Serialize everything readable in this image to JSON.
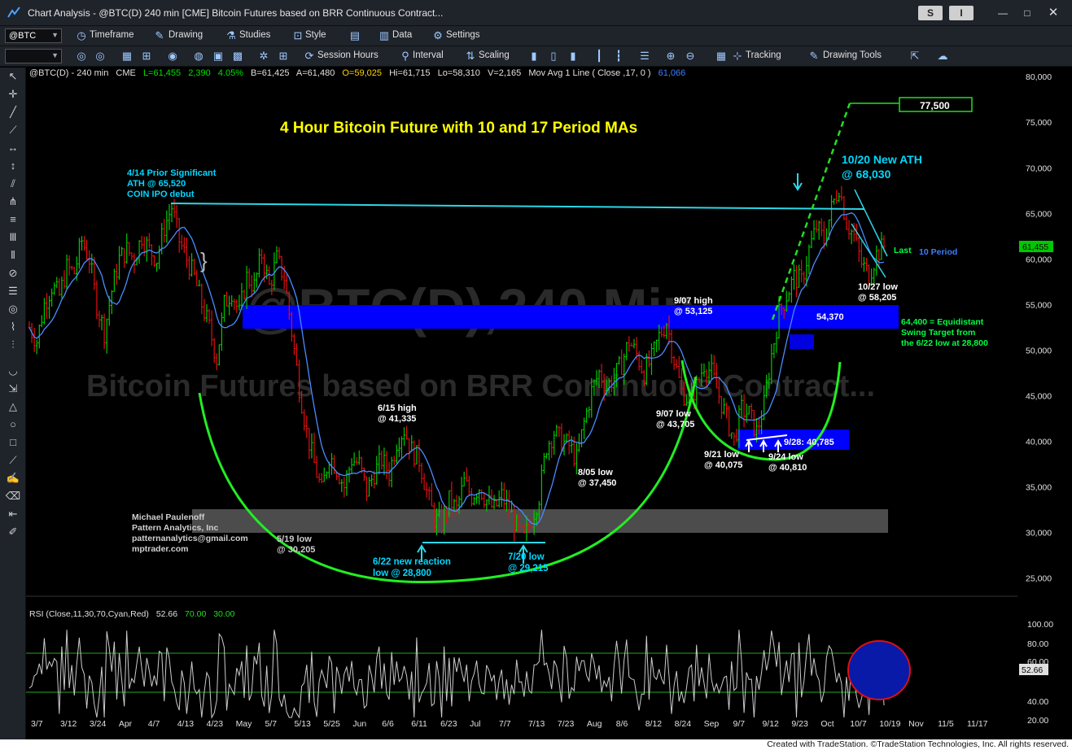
{
  "window": {
    "title": "Chart Analysis - @BTC(D) 240 min [CME] Bitcoin Futures based on BRR Continuous Contract...",
    "s_button": "S",
    "i_button": "I",
    "minimize": "—",
    "maximize": "□",
    "close": "✕"
  },
  "toolbar1": {
    "symbol": "@BTC",
    "timeframe": "Timeframe",
    "drawing": "Drawing",
    "studies": "Studies",
    "style": "Style",
    "data": "Data",
    "settings": "Settings"
  },
  "toolbar2": {
    "session_hours": "Session Hours",
    "interval": "Interval",
    "scaling": "Scaling",
    "tracking": "Tracking",
    "drawing_tools": "Drawing Tools"
  },
  "header": {
    "symbol": "@BTC(D) - 240 min",
    "exchange": "CME",
    "last": "L=61,455",
    "change": "2,390",
    "change_pct": "4.05%",
    "bid": "B=61,425",
    "ask": "A=61,480",
    "open": "O=59,025",
    "high": "Hi=61,715",
    "low": "Lo=58,310",
    "volume": "V=2,165",
    "mov_avg": "Mov Avg 1 Line ( Close ,17, 0 )",
    "mov_avg_value": "61,066"
  },
  "watermark": {
    "line1": "@BTC(D),240 Min",
    "line2": "Bitcoin Futures based on BRR Continuous Contract..."
  },
  "credit_block": {
    "name": "Michael Paulenoff",
    "company": "Pattern Analytics, Inc",
    "email": "patternanalytics@gmail.com",
    "site": "mptrader.com"
  },
  "rsi_panel": {
    "label": "RSI (Close,11,30,70,Cyan,Red)",
    "value": "52.66",
    "ob": "70.00",
    "os": "30.00",
    "axis_ticks": [
      "100.00",
      "80.00",
      "60.00",
      "40.00",
      "20.00"
    ],
    "current_value_box": "52.66"
  },
  "footer": {
    "credit": "Created with TradeStation. ©TradeStation Technologies, Inc. All rights reserved."
  },
  "chart_data": {
    "type": "line",
    "title": "4 Hour Bitcoin Future with 10 and 17 Period MAs",
    "ylim": [
      23000,
      81000
    ],
    "y_ticks": [
      80000,
      75000,
      70000,
      65000,
      60000,
      55000,
      50000,
      45000,
      40000,
      35000,
      30000,
      25000
    ],
    "y_tick_labels": [
      "80,000",
      "75,000",
      "70,000",
      "65,000",
      "60,000",
      "55,000",
      "50,000",
      "45,000",
      "40,000",
      "35,000",
      "30,000",
      "25,000"
    ],
    "x_tick_labels": [
      "3/7",
      "3/12",
      "3/24",
      "Apr",
      "4/7",
      "4/13",
      "4/23",
      "May",
      "5/7",
      "5/13",
      "5/25",
      "Jun",
      "6/6",
      "6/11",
      "6/23",
      "Jul",
      "7/7",
      "7/13",
      "7/23",
      "Aug",
      "8/6",
      "8/12",
      "8/24",
      "Sep",
      "9/7",
      "9/12",
      "9/23",
      "Oct",
      "10/7",
      "10/19",
      "Nov",
      "11/5",
      "11/17"
    ],
    "last_price_label": "61,455",
    "series_labels": [
      "Last",
      "10 Period"
    ],
    "price_path": [
      [
        0,
        52500
      ],
      [
        3,
        51000
      ],
      [
        6,
        55000
      ],
      [
        9,
        57000
      ],
      [
        12,
        56000
      ],
      [
        15,
        59000
      ],
      [
        18,
        58500
      ],
      [
        21,
        62000
      ],
      [
        24,
        60000
      ],
      [
        27,
        55000
      ],
      [
        30,
        52000
      ],
      [
        33,
        56500
      ],
      [
        36,
        60000
      ],
      [
        39,
        61000
      ],
      [
        42,
        60000
      ],
      [
        45,
        62500
      ],
      [
        48,
        61000
      ],
      [
        51,
        60000
      ],
      [
        54,
        63500
      ],
      [
        57,
        65700
      ],
      [
        60,
        62000
      ],
      [
        63,
        60000
      ],
      [
        66,
        58000
      ],
      [
        69,
        55000
      ],
      [
        72,
        52500
      ],
      [
        75,
        49000
      ],
      [
        78,
        55000
      ],
      [
        81,
        56500
      ],
      [
        84,
        54000
      ],
      [
        87,
        58000
      ],
      [
        90,
        57000
      ],
      [
        93,
        60500
      ],
      [
        96,
        57000
      ],
      [
        99,
        60000
      ],
      [
        102,
        58000
      ],
      [
        105,
        52000
      ],
      [
        108,
        46000
      ],
      [
        111,
        41000
      ],
      [
        114,
        37500
      ],
      [
        117,
        34500
      ],
      [
        120,
        38500
      ],
      [
        123,
        37000
      ],
      [
        126,
        35000
      ],
      [
        129,
        38000
      ],
      [
        132,
        37500
      ],
      [
        135,
        34500
      ],
      [
        138,
        36500
      ],
      [
        141,
        38000
      ],
      [
        144,
        36500
      ],
      [
        147,
        40000
      ],
      [
        150,
        41300
      ],
      [
        153,
        39000
      ],
      [
        156,
        38000
      ],
      [
        159,
        34500
      ],
      [
        162,
        31500
      ],
      [
        165,
        31000
      ],
      [
        168,
        33500
      ],
      [
        171,
        32500
      ],
      [
        174,
        35500
      ],
      [
        177,
        34000
      ],
      [
        180,
        35000
      ],
      [
        183,
        33500
      ],
      [
        186,
        32500
      ],
      [
        189,
        34000
      ],
      [
        192,
        32500
      ],
      [
        195,
        30500
      ],
      [
        198,
        29300
      ],
      [
        201,
        31500
      ],
      [
        204,
        34000
      ],
      [
        207,
        39500
      ],
      [
        210,
        41000
      ],
      [
        213,
        40000
      ],
      [
        216,
        39500
      ],
      [
        219,
        38000
      ],
      [
        222,
        42000
      ],
      [
        225,
        45500
      ],
      [
        228,
        47500
      ],
      [
        231,
        46000
      ],
      [
        234,
        47000
      ],
      [
        237,
        48500
      ],
      [
        240,
        51000
      ],
      [
        243,
        49500
      ],
      [
        246,
        47500
      ],
      [
        249,
        49000
      ],
      [
        252,
        51500
      ],
      [
        255,
        53100
      ],
      [
        258,
        49000
      ],
      [
        261,
        45500
      ],
      [
        264,
        44500
      ],
      [
        267,
        46000
      ],
      [
        270,
        48500
      ],
      [
        273,
        47500
      ],
      [
        276,
        45000
      ],
      [
        279,
        42500
      ],
      [
        282,
        40100
      ],
      [
        285,
        43500
      ],
      [
        288,
        43000
      ],
      [
        291,
        41000
      ],
      [
        294,
        44000
      ],
      [
        297,
        49500
      ],
      [
        300,
        54000
      ],
      [
        303,
        56000
      ],
      [
        306,
        58000
      ],
      [
        309,
        57500
      ],
      [
        312,
        61000
      ],
      [
        315,
        63500
      ],
      [
        318,
        62000
      ],
      [
        321,
        65500
      ],
      [
        324,
        68000
      ],
      [
        327,
        64000
      ],
      [
        330,
        62500
      ],
      [
        333,
        59500
      ],
      [
        336,
        58200
      ],
      [
        339,
        60500
      ],
      [
        342,
        61455
      ]
    ],
    "annotations": [
      {
        "text": "4/14 Prior Significant",
        "color": "#00d8ff"
      },
      {
        "text": "ATH @ 65,520",
        "color": "#00d8ff"
      },
      {
        "text": "COIN IPO debut",
        "color": "#00d8ff"
      },
      {
        "text": "10/20 New ATH",
        "color": "#00d8ff"
      },
      {
        "text": "@ 68,030",
        "color": "#00d8ff"
      },
      {
        "text": "77,500",
        "color": "#ffffff"
      },
      {
        "text": "9/07 high",
        "color": "#ffffff"
      },
      {
        "text": "@ 53,125",
        "color": "#ffffff"
      },
      {
        "text": "54,370",
        "color": "#ffffff"
      },
      {
        "text": "10/27 low",
        "color": "#ffffff"
      },
      {
        "text": "@ 58,205",
        "color": "#ffffff"
      },
      {
        "text": "64,400 = Equidistant",
        "color": "#00ff44"
      },
      {
        "text": "Swing Target from",
        "color": "#00ff44"
      },
      {
        "text": "the 6/22 low at 28,800",
        "color": "#00ff44"
      },
      {
        "text": "6/15 high",
        "color": "#ffffff"
      },
      {
        "text": "@ 41,335",
        "color": "#ffffff"
      },
      {
        "text": "9/07 low",
        "color": "#ffffff"
      },
      {
        "text": "@ 43,705",
        "color": "#ffffff"
      },
      {
        "text": "8/05 low",
        "color": "#ffffff"
      },
      {
        "text": "@ 37,450",
        "color": "#ffffff"
      },
      {
        "text": "9/21 low",
        "color": "#ffffff"
      },
      {
        "text": "@ 40,075",
        "color": "#ffffff"
      },
      {
        "text": "9/24 low",
        "color": "#ffffff"
      },
      {
        "text": "@ 40,810",
        "color": "#ffffff"
      },
      {
        "text": "9/28: 40,785",
        "color": "#ffffff"
      },
      {
        "text": "5/19 low",
        "color": "#ffffff"
      },
      {
        "text": "@ 30,205",
        "color": "#ffffff"
      },
      {
        "text": "6/22 new reaction",
        "color": "#00d8ff"
      },
      {
        "text": "low @ 28,800",
        "color": "#00d8ff"
      },
      {
        "text": "7/20 low",
        "color": "#00d8ff"
      },
      {
        "text": "@ 29,215",
        "color": "#00d8ff"
      }
    ],
    "colors": {
      "background": "#000000",
      "bars_up": "#00c800",
      "bars_down": "#e01010",
      "ma": "#4a8cff",
      "ath_line": "#2bd8e8",
      "target_line": "#22dd22",
      "cup_arc": "#22ee22",
      "blue_zone": "#0000ff",
      "gray_zone": "#505050",
      "title": "#ffff00"
    }
  }
}
